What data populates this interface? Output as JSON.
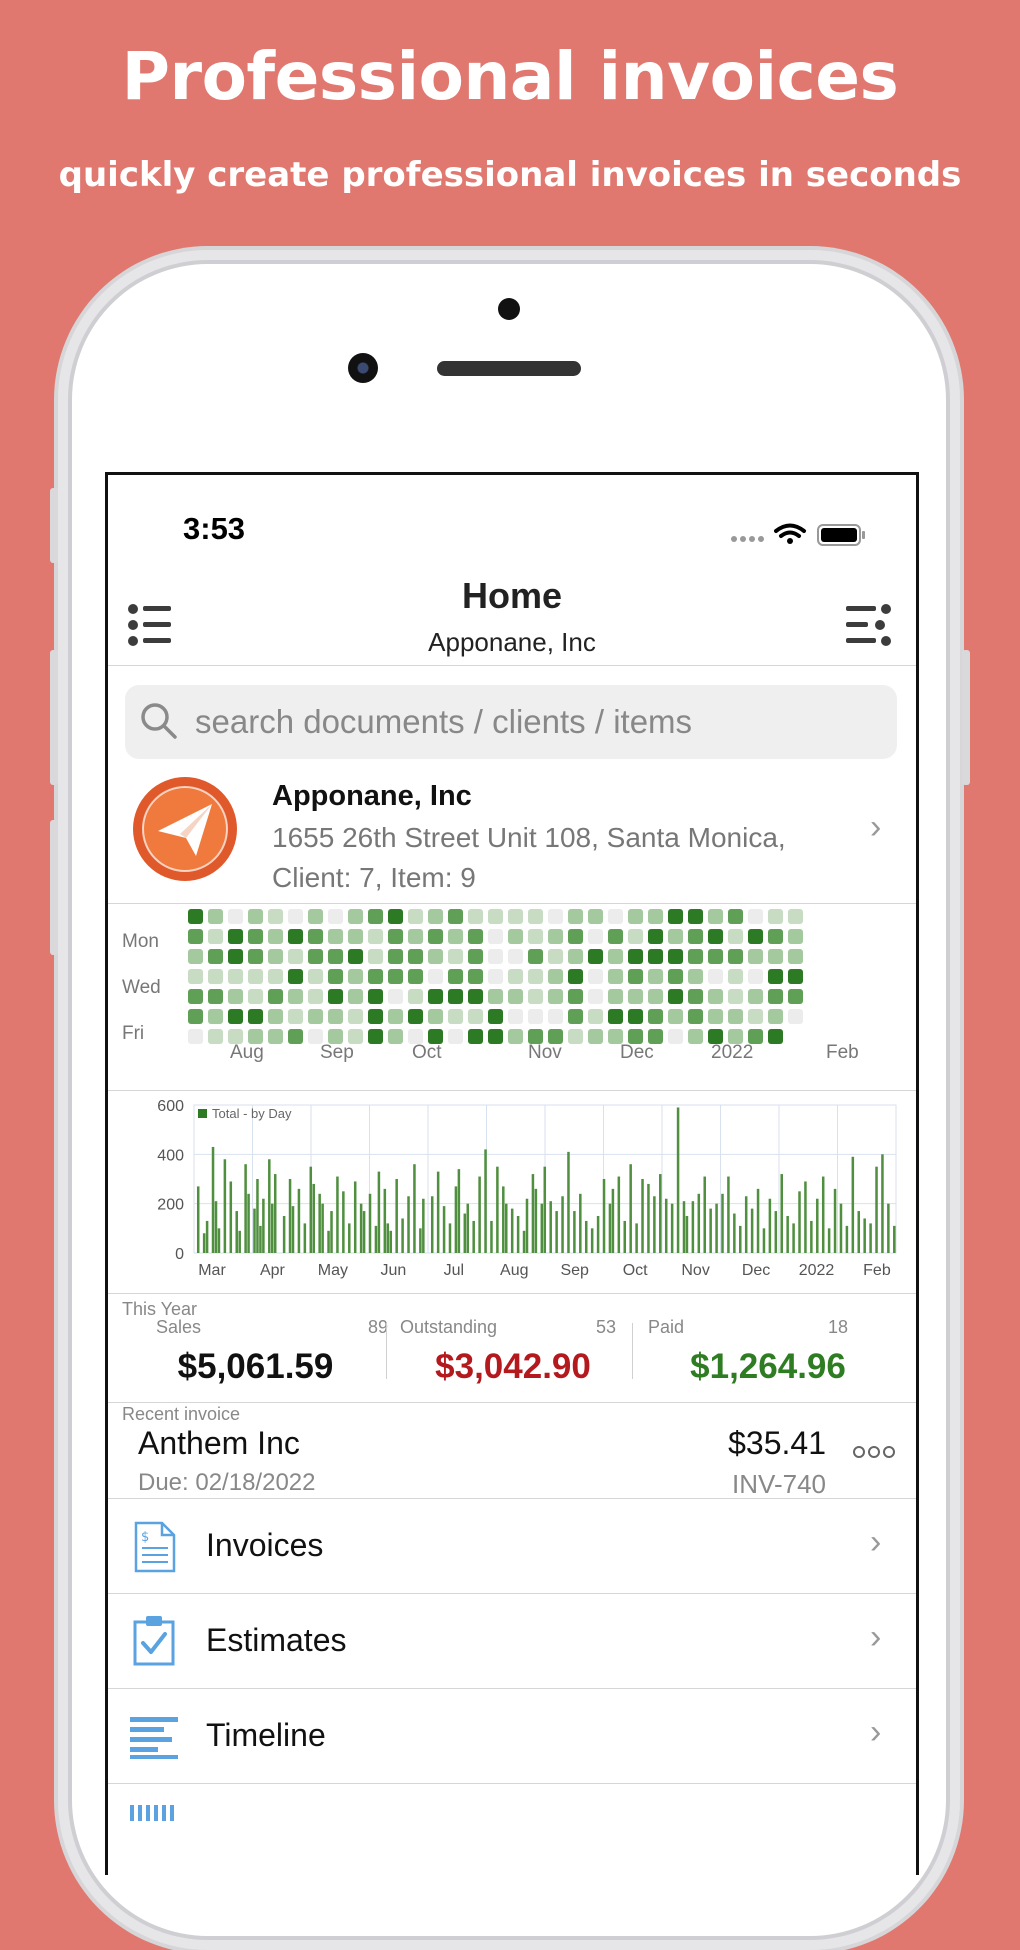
{
  "hero": {
    "title": "Professional invoices",
    "subtitle": "quickly create professional invoices in seconds"
  },
  "status_bar": {
    "time": "3:53",
    "icons": [
      "signal-dots-icon",
      "wifi-icon",
      "battery-icon"
    ]
  },
  "nav": {
    "title": "Home",
    "subtitle": "Apponane, Inc",
    "left_icon": "list-icon",
    "right_icon": "options-list-icon"
  },
  "search": {
    "placeholder": "search documents / clients / items"
  },
  "company": {
    "name": "Apponane, Inc",
    "address": "1655 26th Street Unit 108, Santa Monica,",
    "counts": "Client: 7,  Item: 9",
    "logo_icon": "paper-plane-icon"
  },
  "heatmap": {
    "day_labels": [
      "Mon",
      "Wed",
      "Fri"
    ],
    "month_labels": [
      "Aug",
      "Sep",
      "Oct",
      "Nov",
      "Dec",
      "2022",
      "Feb"
    ],
    "colors": [
      "#ececec",
      "#c8dcc4",
      "#a5c99e",
      "#5f9f56",
      "#2d7a24"
    ]
  },
  "chart_data": {
    "type": "bar",
    "legend": "Total - by Day",
    "x_labels": [
      "Mar",
      "Apr",
      "May",
      "Jun",
      "Jul",
      "Aug",
      "Sep",
      "Oct",
      "Nov",
      "Dec",
      "2022",
      "Feb"
    ],
    "y_ticks": [
      "600",
      "400",
      "200",
      "0"
    ],
    "ylim": [
      0,
      600
    ],
    "color": "#4f8f3f",
    "values": [
      0,
      270,
      0,
      80,
      130,
      0,
      430,
      210,
      100,
      0,
      380,
      0,
      290,
      0,
      170,
      90,
      0,
      360,
      240,
      0,
      180,
      300,
      110,
      220,
      0,
      380,
      200,
      320,
      0,
      0,
      150,
      0,
      300,
      190,
      0,
      260,
      0,
      120,
      0,
      350,
      280,
      0,
      240,
      200,
      0,
      90,
      170,
      0,
      310,
      0,
      250,
      0,
      120,
      0,
      290,
      0,
      200,
      170,
      0,
      240,
      0,
      110,
      330,
      0,
      260,
      120,
      90,
      0,
      300,
      0,
      140,
      0,
      230,
      0,
      360,
      0,
      100,
      220,
      0,
      0,
      230,
      0,
      330,
      0,
      190,
      0,
      120,
      0,
      270,
      340,
      0,
      160,
      200,
      0,
      130,
      0,
      310,
      0,
      420,
      0,
      130,
      0,
      350,
      0,
      270,
      200,
      0,
      180,
      0,
      150,
      0,
      90,
      220,
      0,
      320,
      260,
      0,
      200,
      350,
      0,
      210,
      0,
      170,
      0,
      230,
      0,
      410,
      0,
      170,
      0,
      240,
      0,
      130,
      0,
      100,
      0,
      150,
      0,
      300,
      0,
      200,
      260,
      0,
      310,
      0,
      130,
      0,
      360,
      0,
      120,
      0,
      300,
      0,
      280,
      0,
      230,
      0,
      320,
      0,
      220,
      0,
      200,
      0,
      590,
      0,
      210,
      150,
      0,
      210,
      0,
      240,
      0,
      310,
      0,
      180,
      0,
      200,
      0,
      240,
      0,
      310,
      0,
      160,
      0,
      110,
      0,
      230,
      0,
      180,
      0,
      260,
      0,
      100,
      0,
      220,
      0,
      170,
      0,
      320,
      0,
      150,
      0,
      120,
      0,
      250,
      0,
      290,
      0,
      130,
      0,
      220,
      0,
      310,
      0,
      100,
      0,
      260,
      0,
      200,
      0,
      110,
      0,
      390,
      0,
      170,
      0,
      140,
      0,
      120,
      0,
      350,
      0,
      400,
      0,
      200,
      0,
      110
    ]
  },
  "stats": {
    "period": "This Year",
    "sales": {
      "label": "Sales",
      "count": "89",
      "value": "$5,061.59",
      "color": "#111111"
    },
    "outstanding": {
      "label": "Outstanding",
      "count": "53",
      "value": "$3,042.90",
      "color": "#b4191d"
    },
    "paid": {
      "label": "Paid",
      "count": "18",
      "value": "$1,264.96",
      "color": "#2f7d22"
    }
  },
  "recent": {
    "header": "Recent invoice",
    "client": "Anthem Inc",
    "due": "Due: 02/18/2022",
    "amount": "$35.41",
    "number": "INV-740"
  },
  "menu": [
    {
      "label": "Invoices",
      "icon": "invoice-document-icon"
    },
    {
      "label": "Estimates",
      "icon": "clipboard-check-icon"
    },
    {
      "label": "Timeline",
      "icon": "timeline-bars-icon"
    }
  ]
}
